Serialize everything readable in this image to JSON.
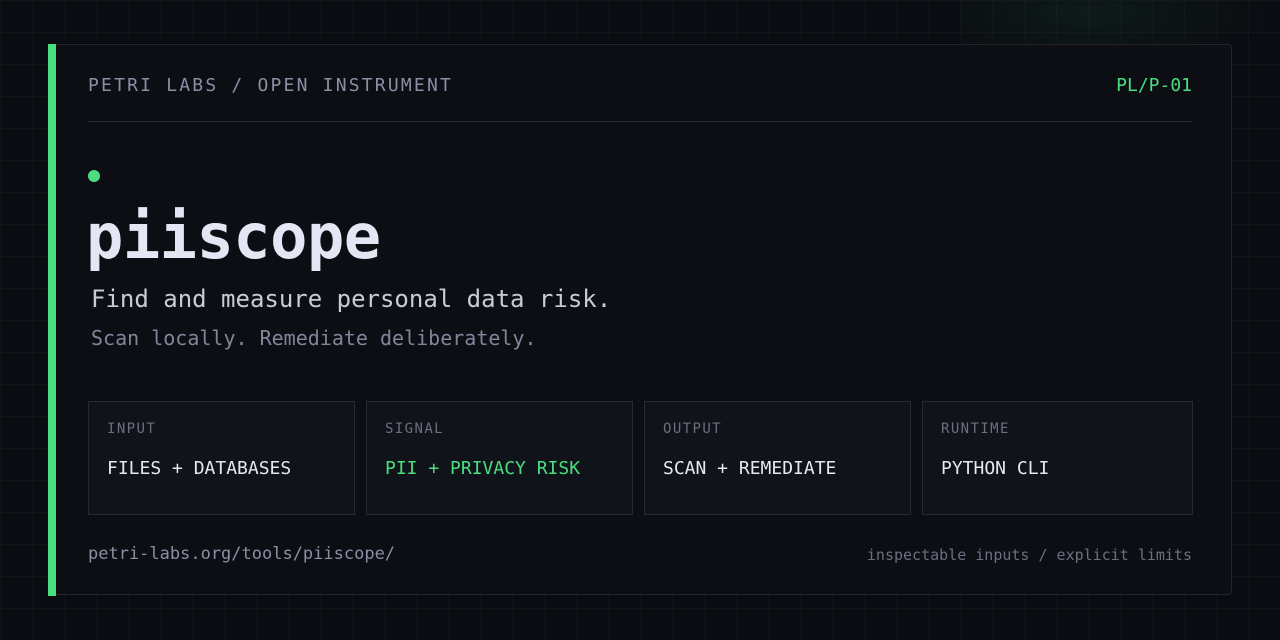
{
  "header": {
    "brand": "PETRI LABS / OPEN INSTRUMENT",
    "code": "PL/P-01"
  },
  "hero": {
    "title": "piiscope",
    "tagline": "Find and measure personal data risk.",
    "subtagline": "Scan locally. Remediate deliberately."
  },
  "specs": [
    {
      "label": "INPUT",
      "value": "FILES + DATABASES"
    },
    {
      "label": "SIGNAL",
      "value": "PII + PRIVACY RISK"
    },
    {
      "label": "OUTPUT",
      "value": "SCAN + REMEDIATE"
    },
    {
      "label": "RUNTIME",
      "value": "PYTHON CLI"
    }
  ],
  "footer": {
    "url": "petri-labs.org/tools/piiscope/",
    "note": "inspectable inputs / explicit limits"
  },
  "colors": {
    "background": "#0a0c11",
    "card": "#0c0e14",
    "accent": "#4ade80",
    "text_primary": "#e4e6f3",
    "text_muted": "#8b8fa3"
  }
}
